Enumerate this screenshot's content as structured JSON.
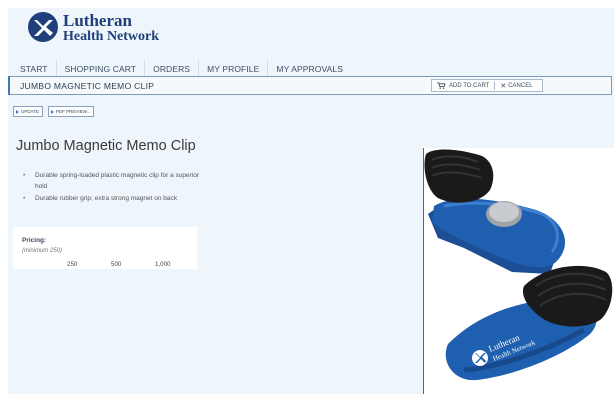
{
  "brand": {
    "line1": "Lutheran",
    "line2": "Health Network",
    "color": "#1f3f7a"
  },
  "nav": {
    "items": [
      "START",
      "SHOPPING CART",
      "ORDERS",
      "MY PROFILE",
      "MY APPROVALS"
    ]
  },
  "titlebar": {
    "title": "JUMBO MAGNETIC MEMO CLIP",
    "add_to_cart": "ADD TO CART",
    "cancel": "CANCEL"
  },
  "actions": {
    "update": "UPDATE",
    "pdf_preview": "PDF PREVIEW..."
  },
  "product": {
    "title": "Jumbo Magnetic Memo Clip",
    "bullets": [
      "Durable spring-loaded plastic magnetic clip for a superior hold",
      "Durable rubber grip; extra strong magnet on back"
    ]
  },
  "pricing": {
    "label": "Pricing:",
    "minimum": "(minimum 250)",
    "quantities": [
      "250",
      "500",
      "1,000"
    ]
  },
  "image": {
    "clip_imprint_line1": "Lutheran",
    "clip_imprint_line2": "Health Network",
    "clip_color": "#1f5fb0"
  },
  "colors": {
    "accent": "#4478b3",
    "page_bg": "#eef5fb"
  }
}
